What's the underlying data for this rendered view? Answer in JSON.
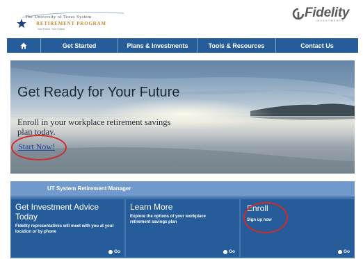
{
  "header": {
    "ut_logo": {
      "line1": "The University of Texas System",
      "line2": "RETIREMENT PROGRAM",
      "line3": "Your Future. Your Choice."
    },
    "fidelity_logo": {
      "word": "Fidelity",
      "sub": "INVESTMENTS"
    }
  },
  "nav": {
    "home_icon": "home-icon",
    "items": [
      {
        "label": "Get Started"
      },
      {
        "label": "Plans & Investments"
      },
      {
        "label": "Tools & Resources"
      },
      {
        "label": "Contact Us"
      }
    ]
  },
  "hero": {
    "title": "Get Ready for Your Future",
    "subtitle": "Enroll in your workplace retirement savings plan today.",
    "link": "Start Now!"
  },
  "panel": {
    "header": "UT System Retirement Manager",
    "cards": [
      {
        "title": "Get Investment Advice Today",
        "desc": "Fidelity representatives will meet with you at your location or by phone",
        "go": "Go"
      },
      {
        "title": "Learn More",
        "desc": "Explore the options of your workplace retirement savings plan",
        "go": "Go"
      },
      {
        "title": "Enroll",
        "desc": "Sign up now",
        "go": "Go"
      }
    ]
  },
  "colors": {
    "nav_bg": "#255c99",
    "panel_bg": "#4276ad",
    "panel_header": "#6f9acb",
    "highlight_circle": "#cf2b2b"
  }
}
